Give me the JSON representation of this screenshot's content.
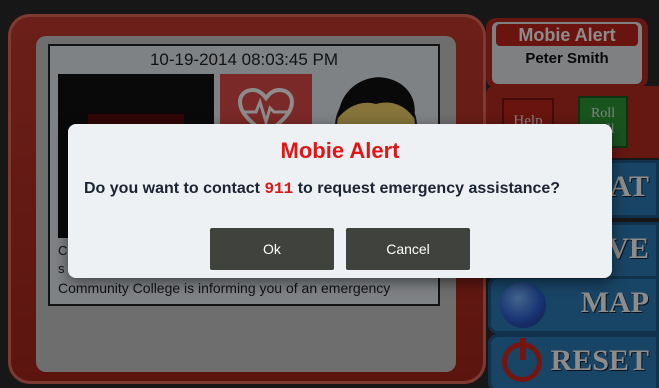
{
  "app": {
    "brand": "Mobie Alert",
    "user_name": "Peter Smith"
  },
  "card": {
    "datetime": "10-19-2014 08:03:45 PM",
    "text_line1_start": "C",
    "text_line2_start": "s",
    "message": "Community College is informing you of an emergency"
  },
  "side": {
    "help_label": "Help",
    "roll_label": "Roll Call",
    "chat_label": "AT",
    "save_label": "VE",
    "map_label": "MAP",
    "reset_label": "RESET"
  },
  "dialog": {
    "title": "Mobie Alert",
    "msg_pre": "Do you want to contact ",
    "number": "911",
    "msg_post": " to request emergency assistance?",
    "ok_label": "Ok",
    "cancel_label": "Cancel"
  },
  "colors": {
    "accent_red": "#e01616",
    "frame_red": "#b82a1f",
    "button_blue": "#2c7db8",
    "dialog_bg": "#eef1f4"
  },
  "icons": [
    "heart-monitor-icon",
    "avatar-icon",
    "globe-icon",
    "power-icon"
  ]
}
